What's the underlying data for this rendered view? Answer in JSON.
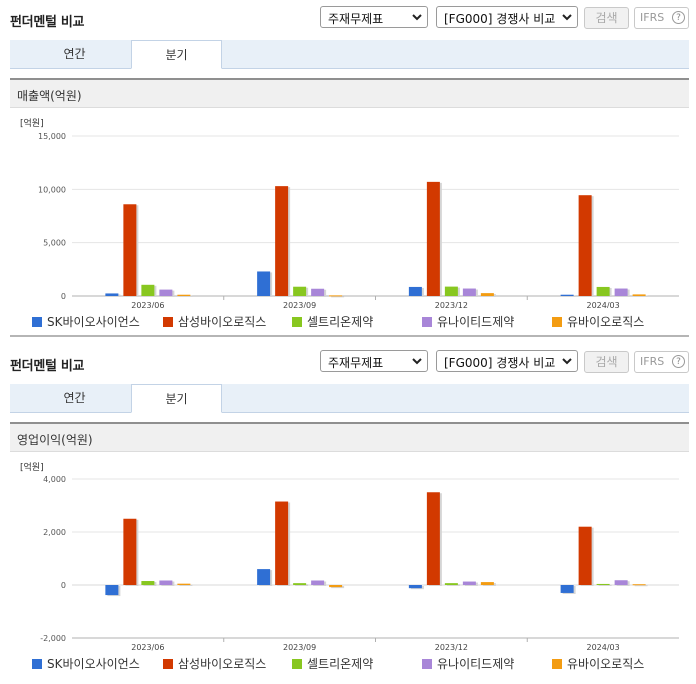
{
  "colors": {
    "sk": "#2f6fd4",
    "samsung": "#d23900",
    "celltrion": "#88c720",
    "unai": "#a886d8",
    "yubio": "#f39c12"
  },
  "panels": [
    {
      "title": "펀더멘털 비교",
      "select1": "주재무제표",
      "select2": "[FG000] 경쟁사 비교",
      "search_label": "검색",
      "ifrs_label": "IFRS",
      "help_glyph": "?",
      "tabs": [
        {
          "label": "연간"
        },
        {
          "label": "분기"
        }
      ],
      "active_tab": 1,
      "section_label": "매출액(억원)"
    },
    {
      "title": "펀더멘털 비교",
      "select1": "주재무제표",
      "select2": "[FG000] 경쟁사 비교",
      "search_label": "검색",
      "ifrs_label": "IFRS",
      "help_glyph": "?",
      "tabs": [
        {
          "label": "연간"
        },
        {
          "label": "분기"
        }
      ],
      "active_tab": 1,
      "section_label": "영업이익(억원)"
    }
  ],
  "chart_data": [
    {
      "type": "bar",
      "unit_label": "[억원]",
      "categories": [
        "2023/06",
        "2023/09",
        "2023/12",
        "2024/03"
      ],
      "ylim": [
        0,
        15000
      ],
      "yticks": [
        "0",
        "5,000",
        "10,000",
        "15,000"
      ],
      "ytick_values": [
        0,
        5000,
        10000,
        15000
      ],
      "grid": true,
      "legend_position": "bottom",
      "series": [
        {
          "name": "SK바이오사이언스",
          "values": [
            240,
            2300,
            850,
            120
          ]
        },
        {
          "name": "삼성바이오로직스",
          "values": [
            8600,
            10300,
            10700,
            9450
          ]
        },
        {
          "name": "셀트리온제약",
          "values": [
            1050,
            870,
            880,
            850
          ]
        },
        {
          "name": "유나이티드제약",
          "values": [
            600,
            680,
            700,
            700
          ]
        },
        {
          "name": "유바이오로직스",
          "values": [
            120,
            60,
            270,
            150
          ]
        }
      ]
    },
    {
      "type": "bar",
      "unit_label": "[억원]",
      "categories": [
        "2023/06",
        "2023/09",
        "2023/12",
        "2024/03"
      ],
      "ylim": [
        -2000,
        4000
      ],
      "yticks": [
        "-2,000",
        "0",
        "2,000",
        "4,000"
      ],
      "ytick_values": [
        -2000,
        0,
        2000,
        4000
      ],
      "grid": true,
      "legend_position": "bottom",
      "series": [
        {
          "name": "SK바이오사이언스",
          "values": [
            -380,
            600,
            -120,
            -300
          ]
        },
        {
          "name": "삼성바이오로직스",
          "values": [
            2500,
            3150,
            3500,
            2200
          ]
        },
        {
          "name": "셀트리온제약",
          "values": [
            150,
            70,
            70,
            40
          ]
        },
        {
          "name": "유나이티드제약",
          "values": [
            170,
            170,
            130,
            180
          ]
        },
        {
          "name": "유바이오로직스",
          "values": [
            50,
            -80,
            110,
            30
          ]
        }
      ]
    }
  ]
}
